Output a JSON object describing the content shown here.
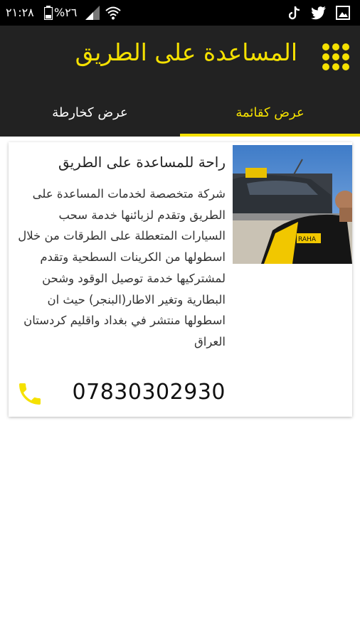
{
  "status_bar": {
    "time": "٢١:٢٨",
    "battery": "%٢٦"
  },
  "app_bar": {
    "title": "المساعدة على الطريق",
    "menu_icon": "grid-icon"
  },
  "tabs": [
    {
      "label": "عرض كقائمة",
      "selected": true
    },
    {
      "label": "عرض كخارطة",
      "selected": false
    }
  ],
  "colors": {
    "accent": "#f5e100",
    "bar": "#222222"
  },
  "card": {
    "title": "راحة للمساعدة على الطريق",
    "description": "شركة متخصصة لخدمات المساعدة على الطريق وتقدم لزبائنها خدمة سحب السيارات المتعطلة على الطرقات من خلال اسطولها من الكرينات السطحية وتقدم لمشتركيها خدمة توصيل الوقود وشحن البطارية وتغير الاطار(البنجر) حيث ان اسطولها منتشر  في بغداد واقليم كردستان العراق",
    "phone": "07830302930",
    "phone_icon": "phone-icon"
  }
}
